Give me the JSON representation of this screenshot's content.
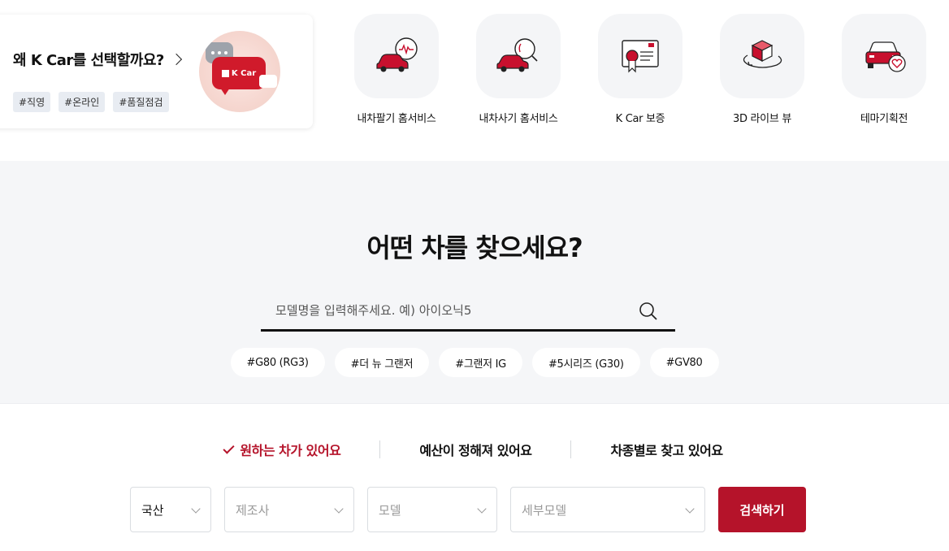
{
  "why": {
    "title": "왜 K Car를 선택할까요?",
    "tags": [
      "#직영",
      "#온라인",
      "#품질점검"
    ],
    "bubble_text": "K Car"
  },
  "services": [
    {
      "label": "내차팔기 홈서비스",
      "icon": "car-sell-icon"
    },
    {
      "label": "내차사기 홈서비스",
      "icon": "car-buy-search-icon"
    },
    {
      "label": "K Car 보증",
      "icon": "warranty-certificate-icon"
    },
    {
      "label": "3D 라이브 뷰",
      "icon": "3d-rotate-icon"
    },
    {
      "label": "테마기획전",
      "icon": "theme-car-heart-icon"
    }
  ],
  "search": {
    "title": "어떤 차를 찾으세요?",
    "placeholder": "모델명을 입력해주세요. 예) 아이오닉5",
    "keywords": [
      "#G80 (RG3)",
      "#더 뉴 그랜저",
      "#그랜저 IG",
      "#5시리즈 (G30)",
      "#GV80"
    ]
  },
  "filter": {
    "tabs": [
      "원하는 차가 있어요",
      "예산이 정해져 있어요",
      "차종별로 찾고 있어요"
    ],
    "active_tab": 0,
    "selects": [
      {
        "value": "국산",
        "filled": true
      },
      {
        "value": "제조사",
        "filled": false
      },
      {
        "value": "모델",
        "filled": false
      },
      {
        "value": "세부모델",
        "filled": false
      }
    ],
    "search_button": "검색하기"
  },
  "colors": {
    "accent": "#b5132a",
    "section_bg": "#f5f6f8",
    "icon_bg": "#f4f5f7",
    "tag_bg": "#e8ecf2"
  }
}
